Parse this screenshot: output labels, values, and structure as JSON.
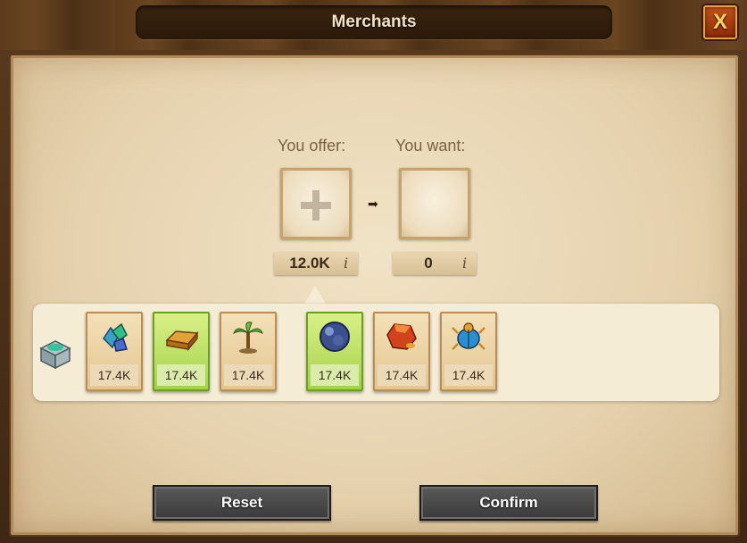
{
  "window": {
    "title": "Merchants",
    "close_label": "X"
  },
  "trade": {
    "offer_caption": "You offer:",
    "want_caption": "You want:",
    "offer_amount": "12.0K",
    "want_amount": "0"
  },
  "goods": [
    {
      "icon": "gem-cluster-icon",
      "amount": "17.4K",
      "selected": false
    },
    {
      "icon": "gold-bar-icon",
      "amount": "17.4K",
      "selected": true
    },
    {
      "icon": "palm-plant-icon",
      "amount": "17.4K",
      "selected": false
    },
    {
      "icon": "magic-orb-icon",
      "amount": "17.4K",
      "selected": true
    },
    {
      "icon": "red-crystal-icon",
      "amount": "17.4K",
      "selected": false
    },
    {
      "icon": "scarab-icon",
      "amount": "17.4K",
      "selected": false
    }
  ],
  "buttons": {
    "reset": "Reset",
    "confirm": "Confirm"
  }
}
